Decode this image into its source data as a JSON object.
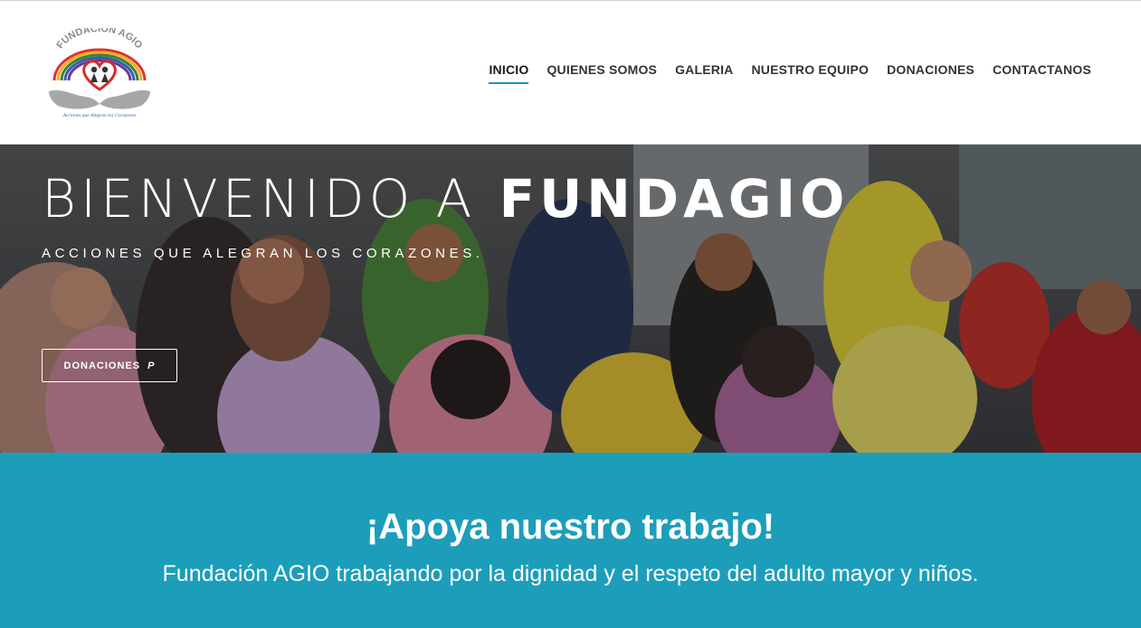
{
  "header": {
    "logo": {
      "arc_text": "FUNDACIÓN AGIO",
      "tagline": "Acciones que Alegran los Corazones",
      "colors": {
        "heart": "#d62b2b",
        "rainbow": [
          "#e0322e",
          "#f2b01e",
          "#3b7f3a",
          "#2f5fb0",
          "#6a3a9a"
        ],
        "hands": "#a7a7a7"
      }
    },
    "nav": [
      {
        "label": "INICIO",
        "active": true
      },
      {
        "label": "QUIENES SOMOS",
        "active": false
      },
      {
        "label": "GALERIA",
        "active": false
      },
      {
        "label": "NUESTRO EQUIPO",
        "active": false
      },
      {
        "label": "DONACIONES",
        "active": false
      },
      {
        "label": "CONTACTANOS",
        "active": false
      }
    ],
    "accent_color": "#1f8fbf"
  },
  "hero": {
    "title_light": "BIENVENIDO A",
    "title_bold": "FUNDAGIO",
    "subtitle": "ACCIONES QUE ALEGRAN LOS CORAZONES.",
    "button_label": "DONACIONES",
    "button_icon": "paypal-icon",
    "button_icon_glyph": "P"
  },
  "support": {
    "title": "¡Apoya nuestro trabajo!",
    "text": "Fundación AGIO trabajando por la dignidad y el respeto del adulto mayor y niños.",
    "background_color": "#1c9ebb"
  }
}
